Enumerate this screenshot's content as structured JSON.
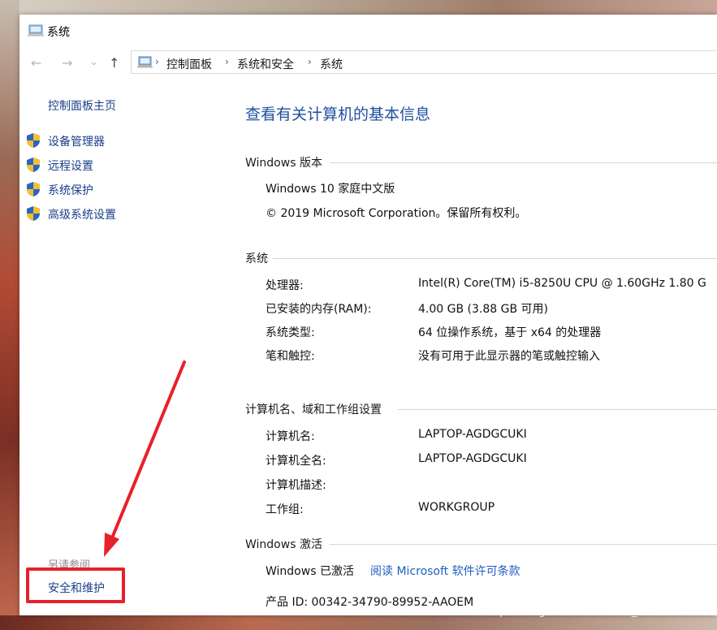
{
  "window": {
    "title": "系统"
  },
  "nav": {
    "back_glyph": "←",
    "forward_glyph": "→",
    "recent_glyph": "⌄",
    "up_glyph": "↑",
    "chevron": "›",
    "breadcrumb": [
      "控制面板",
      "系统和安全",
      "系统"
    ]
  },
  "sidebar": {
    "home": "控制面板主页",
    "items": [
      {
        "label": "设备管理器",
        "icon": "uac-shield-icon"
      },
      {
        "label": "远程设置",
        "icon": "uac-shield-icon"
      },
      {
        "label": "系统保护",
        "icon": "uac-shield-icon"
      },
      {
        "label": "高级系统设置",
        "icon": "uac-shield-icon"
      }
    ],
    "see_also": "另请参阅",
    "security_link": "安全和维护"
  },
  "main": {
    "title": "查看有关计算机的基本信息",
    "edition": {
      "heading": "Windows 版本",
      "name": "Windows 10 家庭中文版",
      "copyright": "© 2019 Microsoft Corporation。保留所有权利。"
    },
    "system": {
      "heading": "系统",
      "rows": [
        {
          "key": "处理器:",
          "value": "Intel(R) Core(TM) i5-8250U CPU @ 1.60GHz   1.80 G"
        },
        {
          "key": "已安装的内存(RAM):",
          "value": "4.00 GB (3.88 GB 可用)"
        },
        {
          "key": "系统类型:",
          "value": "64 位操作系统，基于 x64 的处理器"
        },
        {
          "key": "笔和触控:",
          "value": "没有可用于此显示器的笔或触控输入"
        }
      ]
    },
    "computer": {
      "heading": "计算机名、域和工作组设置",
      "rows": [
        {
          "key": "计算机名:",
          "value": "LAPTOP-AGDGCUKI"
        },
        {
          "key": "计算机全名:",
          "value": "LAPTOP-AGDGCUKI"
        },
        {
          "key": "计算机描述:",
          "value": ""
        },
        {
          "key": "工作组:",
          "value": "WORKGROUP"
        }
      ]
    },
    "activation": {
      "heading": "Windows 激活",
      "status": "Windows 已激活",
      "license_link": "阅读 Microsoft 软件许可条款",
      "product_id": "产品 ID: 00342-34790-89952-AAOEM"
    }
  },
  "overlay": {
    "watermark": "https://blog.csdn.net/weixin_45436630",
    "annotation_color": "#e8202a"
  }
}
